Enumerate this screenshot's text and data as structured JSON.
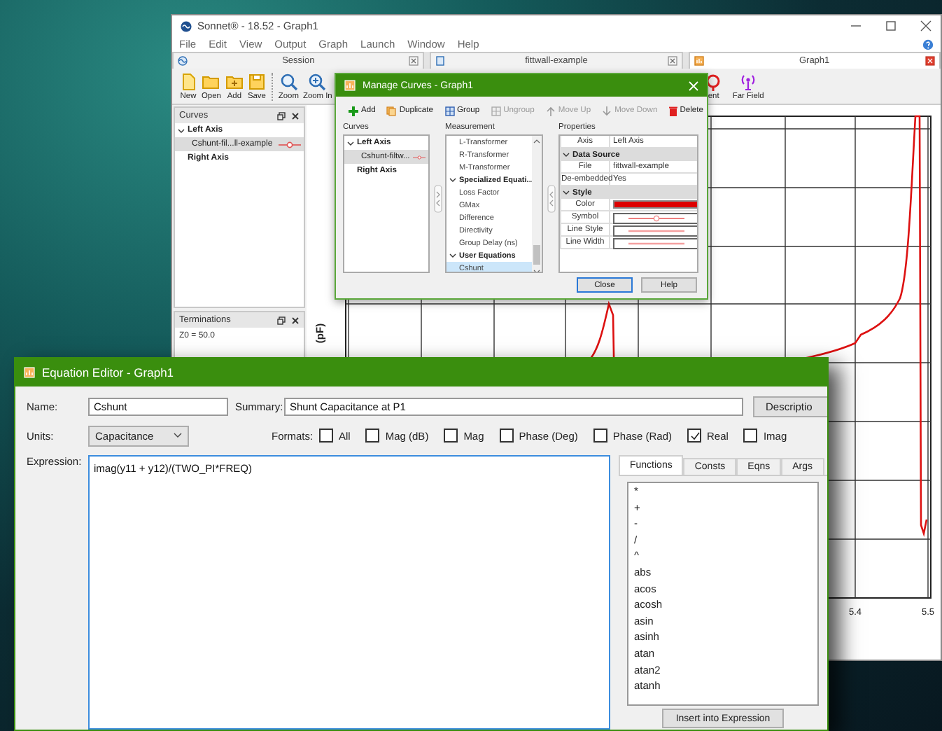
{
  "main_window": {
    "title": "Sonnet® - 18.52 - Graph1",
    "menu": [
      "File",
      "Edit",
      "View",
      "Output",
      "Graph",
      "Launch",
      "Window",
      "Help"
    ],
    "tabs": [
      {
        "label": "Session",
        "kind": "session",
        "selected": false
      },
      {
        "label": "fittwall-example",
        "kind": "project",
        "selected": false
      },
      {
        "label": "Graph1",
        "kind": "graph",
        "selected": true
      }
    ],
    "toolbar": [
      {
        "label": "New",
        "kind": "new"
      },
      {
        "label": "Open",
        "kind": "open"
      },
      {
        "label": "Add",
        "kind": "add"
      },
      {
        "label": "Save",
        "kind": "save"
      },
      {
        "kind": "separator"
      },
      {
        "label": "Zoom",
        "kind": "zoom"
      },
      {
        "label": "Zoom In",
        "kind": "zoom-in"
      },
      {
        "label": "ent",
        "kind": "current"
      },
      {
        "label": "Far Field",
        "kind": "far-field"
      }
    ],
    "curves_panel": {
      "title": "Curves",
      "tree": [
        {
          "label": "Left Axis",
          "expanded": true,
          "children": [
            {
              "label": "Cshunt-fil...ll-example",
              "selected": true
            }
          ]
        },
        {
          "label": "Right Axis",
          "selected": false
        }
      ]
    },
    "terminations_panel": {
      "title": "Terminations",
      "text": "Z0 = 50.0"
    },
    "plot": {
      "y_label": "(pF)",
      "x_ticks": [
        "5.4",
        "5.5"
      ]
    }
  },
  "manage_curves": {
    "title": "Manage Curves - Graph1",
    "toolbar": [
      {
        "label": "Add",
        "kind": "add",
        "disabled": false
      },
      {
        "label": "Duplicate",
        "kind": "duplicate",
        "disabled": false
      },
      {
        "label": "Group",
        "kind": "group",
        "disabled": false
      },
      {
        "label": "Ungroup",
        "kind": "ungroup",
        "disabled": true
      },
      {
        "label": "Move Up",
        "kind": "up",
        "disabled": true
      },
      {
        "label": "Move Down",
        "kind": "down",
        "disabled": true
      },
      {
        "label": "Delete",
        "kind": "delete",
        "disabled": false
      }
    ],
    "curves": {
      "title": "Curves",
      "tree": [
        {
          "label": "Left Axis",
          "expanded": true,
          "children": [
            {
              "label": "Cshunt-filtw...",
              "selected": true
            }
          ]
        },
        {
          "label": "Right Axis",
          "selected": false
        }
      ]
    },
    "measurement": {
      "title": "Measurement",
      "items": [
        {
          "label": "L-Transformer",
          "kind": "item",
          "selected": false
        },
        {
          "label": "R-Transformer",
          "kind": "item",
          "selected": false
        },
        {
          "label": "M-Transformer",
          "kind": "item",
          "selected": false
        },
        {
          "label": "Specialized Equati...",
          "kind": "group",
          "selected": false
        },
        {
          "label": "Loss Factor",
          "kind": "item",
          "selected": false
        },
        {
          "label": "GMax",
          "kind": "item",
          "selected": false
        },
        {
          "label": "Difference",
          "kind": "item",
          "selected": false
        },
        {
          "label": "Directivity",
          "kind": "item",
          "selected": false
        },
        {
          "label": "Group Delay (ns)",
          "kind": "item",
          "selected": false
        },
        {
          "label": "User Equations",
          "kind": "group",
          "selected": false
        },
        {
          "label": "Cshunt",
          "kind": "item",
          "selected": true
        }
      ]
    },
    "properties": {
      "title": "Properties",
      "rows": [
        {
          "kind": "text",
          "name": "Axis",
          "value": "Left Axis"
        },
        {
          "kind": "group",
          "name": "Data Source"
        },
        {
          "kind": "text",
          "name": "File",
          "value": "fittwall-example"
        },
        {
          "kind": "text",
          "name": "De-embedded",
          "value": "Yes"
        },
        {
          "kind": "group",
          "name": "Style"
        },
        {
          "kind": "color",
          "name": "Color",
          "color": "#dd0000"
        },
        {
          "kind": "symbol",
          "name": "Symbol"
        },
        {
          "kind": "line",
          "name": "Line Style"
        },
        {
          "kind": "line",
          "name": "Line Width"
        }
      ]
    },
    "buttons": [
      {
        "label": "Close",
        "default": true
      },
      {
        "label": "Help",
        "default": false
      }
    ]
  },
  "equation_editor": {
    "title": "Equation Editor - Graph1",
    "name_label": "Name:",
    "name": "Cshunt",
    "summary_label": "Summary:",
    "summary": "Shunt Capacitance at P1",
    "description_button": "Descriptio",
    "units_label": "Units:",
    "units": "Capacitance",
    "formats_label": "Formats:",
    "formats": [
      {
        "label": "All",
        "checked": false
      },
      {
        "label": "Mag (dB)",
        "checked": false
      },
      {
        "label": "Mag",
        "checked": false
      },
      {
        "label": "Phase (Deg)",
        "checked": false
      },
      {
        "label": "Phase (Rad)",
        "checked": false
      },
      {
        "label": "Real",
        "checked": true
      },
      {
        "label": "Imag",
        "checked": false
      }
    ],
    "expression_label": "Expression:",
    "expression": "imag(y11 + y12)/(TWO_PI*FREQ)",
    "tabs": [
      {
        "label": "Functions",
        "selected": true
      },
      {
        "label": "Consts",
        "selected": false
      },
      {
        "label": "Eqns",
        "selected": false
      },
      {
        "label": "Args",
        "selected": false
      }
    ],
    "functions": [
      "*",
      "+",
      "-",
      "/",
      "^",
      "abs",
      "acos",
      "acosh",
      "asin",
      "asinh",
      "atan",
      "atan2",
      "atanh"
    ],
    "insert_button": "Insert into Expression"
  }
}
